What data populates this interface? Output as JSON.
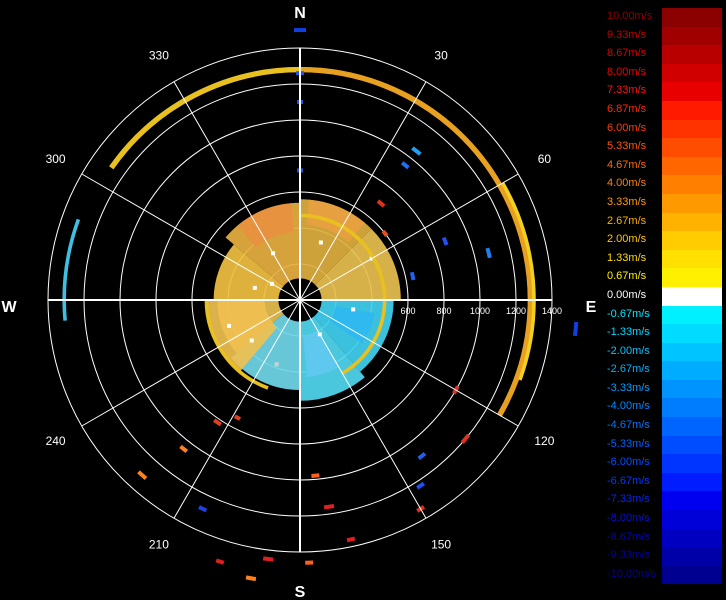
{
  "chart_data": {
    "type": "polar-radar",
    "cardinals": {
      "north": "N",
      "south": "S",
      "east": "E",
      "west": "W"
    },
    "azimuth_labels": [
      {
        "deg": 30,
        "label": "30"
      },
      {
        "deg": 60,
        "label": "60"
      },
      {
        "deg": 120,
        "label": "120"
      },
      {
        "deg": 150,
        "label": "150"
      },
      {
        "deg": 210,
        "label": "210"
      },
      {
        "deg": 240,
        "label": "240"
      },
      {
        "deg": 300,
        "label": "300"
      },
      {
        "deg": 330,
        "label": "330"
      }
    ],
    "range_rings": [
      200,
      400,
      600,
      800,
      1000,
      1200,
      1400
    ],
    "range_labels": [
      {
        "value": 600,
        "label": "600"
      },
      {
        "value": 800,
        "label": "800"
      },
      {
        "value": 1000,
        "label": "1000"
      },
      {
        "value": 1200,
        "label": "1200"
      },
      {
        "value": 1400,
        "label": "1400"
      }
    ],
    "range_max": 1400,
    "legend": [
      {
        "label": "10.00m/s",
        "color": "#8b0000",
        "text": "#8b0000"
      },
      {
        "label": "9.33m/s",
        "color": "#a00000",
        "text": "#c00000"
      },
      {
        "label": "8.67m/s",
        "color": "#b80000",
        "text": "#d40000"
      },
      {
        "label": "8.00m/s",
        "color": "#d00000",
        "text": "#e80000"
      },
      {
        "label": "7.33m/s",
        "color": "#e80000",
        "text": "#ff1010"
      },
      {
        "label": "6.87m/s",
        "color": "#ff1a00",
        "text": "#ff2a00"
      },
      {
        "label": "6.00m/s",
        "color": "#ff3300",
        "text": "#ff3c00"
      },
      {
        "label": "5.33m/s",
        "color": "#ff4d00",
        "text": "#ff5500"
      },
      {
        "label": "4.67m/s",
        "color": "#ff6600",
        "text": "#ff6a00"
      },
      {
        "label": "4.00m/s",
        "color": "#ff7f00",
        "text": "#ff8200"
      },
      {
        "label": "3.33m/s",
        "color": "#ff9900",
        "text": "#ff9a00"
      },
      {
        "label": "2.67m/s",
        "color": "#ffb200",
        "text": "#ffb000"
      },
      {
        "label": "2.00m/s",
        "color": "#ffcc00",
        "text": "#ffc800"
      },
      {
        "label": "1.33m/s",
        "color": "#ffe000",
        "text": "#ffdc00"
      },
      {
        "label": "0.67m/s",
        "color": "#fff000",
        "text": "#fff000"
      },
      {
        "label": "0.00m/s",
        "color": "#ffffff",
        "text": "#ffffff"
      },
      {
        "label": "-0.67m/s",
        "color": "#00f0ff",
        "text": "#00e8ff"
      },
      {
        "label": "-1.33m/s",
        "color": "#00dcff",
        "text": "#00d8ff"
      },
      {
        "label": "-2.00m/s",
        "color": "#00c4ff",
        "text": "#00c4ff"
      },
      {
        "label": "-2.67m/s",
        "color": "#00acff",
        "text": "#00b0ff"
      },
      {
        "label": "-3.33m/s",
        "color": "#0094ff",
        "text": "#009cff"
      },
      {
        "label": "-4.00m/s",
        "color": "#007cff",
        "text": "#0088ff"
      },
      {
        "label": "-4.67m/s",
        "color": "#0064ff",
        "text": "#0074ff"
      },
      {
        "label": "-5.33m/s",
        "color": "#004cff",
        "text": "#0060ff"
      },
      {
        "label": "-6.00m/s",
        "color": "#0034ff",
        "text": "#004cff"
      },
      {
        "label": "-6.67m/s",
        "color": "#001cff",
        "text": "#0038ff"
      },
      {
        "label": "-7.33m/s",
        "color": "#0000f0",
        "text": "#0024f0"
      },
      {
        "label": "-8.00m/s",
        "color": "#0000d8",
        "text": "#0010d8"
      },
      {
        "label": "-8.67m/s",
        "color": "#0000c0",
        "text": "#0000c0"
      },
      {
        "label": "-9.33m/s",
        "color": "#0000a8",
        "text": "#0000a8"
      },
      {
        "label": "-10.00m/s",
        "color": "#000090",
        "text": "#000090"
      }
    ],
    "arcs": [
      {
        "r": 1280,
        "az_start": -55,
        "az_end": 0,
        "width": 30,
        "color": "#e8c020"
      },
      {
        "r": 1280,
        "az_start": 0,
        "az_end": 120,
        "width": 30,
        "color": "#e8a020"
      },
      {
        "r": 1300,
        "az_start": 60,
        "az_end": 110,
        "width": 20,
        "color": "#f0d020"
      },
      {
        "r": 1310,
        "az_start": -95,
        "az_end": -70,
        "width": 20,
        "color": "#40c0e0"
      },
      {
        "r": 470,
        "az_start": 0,
        "az_end": 150,
        "width": 20,
        "color": "#e8c020"
      },
      {
        "r": 520,
        "az_start": -160,
        "az_end": -90,
        "width": 20,
        "color": "#e8c020"
      }
    ],
    "segments": [
      {
        "r": 1500,
        "az": 0,
        "len": 12,
        "color": "#1040e0"
      },
      {
        "r": 1260,
        "az": 0,
        "len": 8,
        "color": "#2050f0"
      },
      {
        "r": 1100,
        "az": 0,
        "len": 6,
        "color": "#2050f0"
      },
      {
        "r": 720,
        "az": 0,
        "len": 6,
        "color": "#2050f0"
      },
      {
        "r": 1050,
        "az": 38,
        "len": 10,
        "color": "#20a0f0"
      },
      {
        "r": 950,
        "az": 38,
        "len": 8,
        "color": "#2070f0"
      },
      {
        "r": 700,
        "az": 40,
        "len": 8,
        "color": "#e03020"
      },
      {
        "r": 600,
        "az": 52,
        "len": 6,
        "color": "#e05020"
      },
      {
        "r": 870,
        "az": 68,
        "len": 8,
        "color": "#2050f0"
      },
      {
        "r": 1080,
        "az": 76,
        "len": 10,
        "color": "#2080f0"
      },
      {
        "r": 640,
        "az": 78,
        "len": 8,
        "color": "#2060f0"
      },
      {
        "r": 1540,
        "az": 96,
        "len": 14,
        "color": "#1040e0"
      },
      {
        "r": 1200,
        "az": 130,
        "len": 10,
        "color": "#e03020"
      },
      {
        "r": 1000,
        "az": 120,
        "len": 8,
        "color": "#e03020"
      },
      {
        "r": 1100,
        "az": 142,
        "len": 8,
        "color": "#2060f0"
      },
      {
        "r": 1230,
        "az": 147,
        "len": 8,
        "color": "#2050f0"
      },
      {
        "r": 1340,
        "az": 150,
        "len": 8,
        "color": "#e03020"
      },
      {
        "r": 980,
        "az": 175,
        "len": 8,
        "color": "#ff6020"
      },
      {
        "r": 1160,
        "az": 172,
        "len": 10,
        "color": "#e02020"
      },
      {
        "r": 1360,
        "az": 168,
        "len": 8,
        "color": "#e02020"
      },
      {
        "r": 1450,
        "az": 187,
        "len": 10,
        "color": "#e02020"
      },
      {
        "r": 1280,
        "az": 205,
        "len": 8,
        "color": "#2040e0"
      },
      {
        "r": 1310,
        "az": 222,
        "len": 10,
        "color": "#ff8020"
      },
      {
        "r": 1050,
        "az": 218,
        "len": 8,
        "color": "#ff8020"
      },
      {
        "r": 820,
        "az": 214,
        "len": 8,
        "color": "#e04020"
      },
      {
        "r": 1570,
        "az": 190,
        "len": 10,
        "color": "#ff8020"
      },
      {
        "r": 1520,
        "az": 197,
        "len": 8,
        "color": "#e02020"
      },
      {
        "r": 1460,
        "az": 178,
        "len": 8,
        "color": "#ff6020"
      },
      {
        "r": 740,
        "az": 208,
        "len": 6,
        "color": "#e04020"
      }
    ],
    "echo": {
      "r_min": 120,
      "r_max": 560,
      "cells": [
        {
          "az_start": -90,
          "az_end": -50,
          "r0": 120,
          "r1": 480,
          "color": "#f0c040"
        },
        {
          "az_start": -50,
          "az_end": 0,
          "r0": 120,
          "r1": 540,
          "color": "#e8b040"
        },
        {
          "az_start": 0,
          "az_end": 45,
          "r0": 120,
          "r1": 560,
          "color": "#e0b040"
        },
        {
          "az_start": 45,
          "az_end": 90,
          "r0": 120,
          "r1": 560,
          "color": "#e8c050"
        },
        {
          "az_start": 90,
          "az_end": 140,
          "r0": 120,
          "r1": 520,
          "color": "#40d0f0"
        },
        {
          "az_start": 140,
          "az_end": 180,
          "r0": 120,
          "r1": 560,
          "color": "#50d8f0"
        },
        {
          "az_start": 180,
          "az_end": 230,
          "r0": 120,
          "r1": 500,
          "color": "#70d8e8"
        },
        {
          "az_start": 230,
          "az_end": 270,
          "r0": 120,
          "r1": 460,
          "color": "#e8c050"
        },
        {
          "az_start": -140,
          "az_end": -90,
          "r0": 200,
          "r1": 520,
          "color": "#f0c050"
        },
        {
          "az_start": -40,
          "az_end": -5,
          "r0": 380,
          "r1": 540,
          "color": "#e89040"
        },
        {
          "az_start": 5,
          "az_end": 40,
          "r0": 420,
          "r1": 560,
          "color": "#e8a040"
        },
        {
          "az_start": 100,
          "az_end": 125,
          "r0": 200,
          "r1": 420,
          "color": "#30b8f0"
        },
        {
          "az_start": 150,
          "az_end": 175,
          "r0": 200,
          "r1": 430,
          "color": "#60c8f0"
        }
      ],
      "specks": [
        {
          "r": 300,
          "az": -30,
          "color": "#ffffff"
        },
        {
          "r": 260,
          "az": -75,
          "color": "#ffffff"
        },
        {
          "r": 340,
          "az": 20,
          "color": "#ffffff"
        },
        {
          "r": 380,
          "az": 200,
          "color": "#d0d0d0"
        },
        {
          "r": 220,
          "az": 150,
          "color": "#ffffff"
        },
        {
          "r": 420,
          "az": -110,
          "color": "#ffffff"
        },
        {
          "r": 300,
          "az": 100,
          "color": "#ffffff"
        },
        {
          "r": 460,
          "az": 60,
          "color": "#ffffff"
        },
        {
          "r": 180,
          "az": -60,
          "color": "#ffffff"
        },
        {
          "r": 350,
          "az": 230,
          "color": "#ffffff"
        }
      ]
    }
  }
}
